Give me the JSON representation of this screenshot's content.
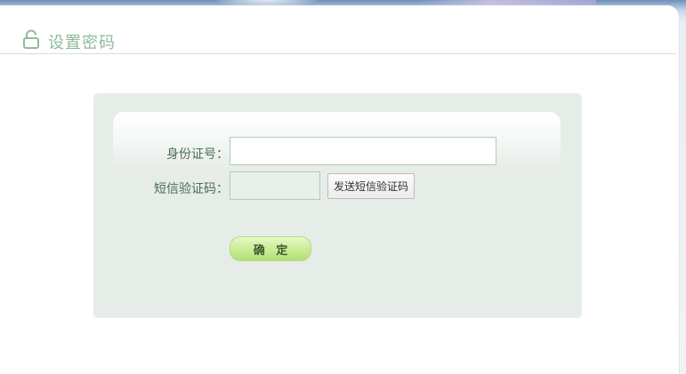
{
  "header": {
    "title": "设置密码",
    "icon": "unlock-icon",
    "accent_color": "#8fba9a"
  },
  "form": {
    "id_label": "身份证号：",
    "id_value": "",
    "sms_label": "短信验证码：",
    "sms_value": "",
    "send_sms_label": "发送短信验证码",
    "confirm_label": "确 定"
  }
}
